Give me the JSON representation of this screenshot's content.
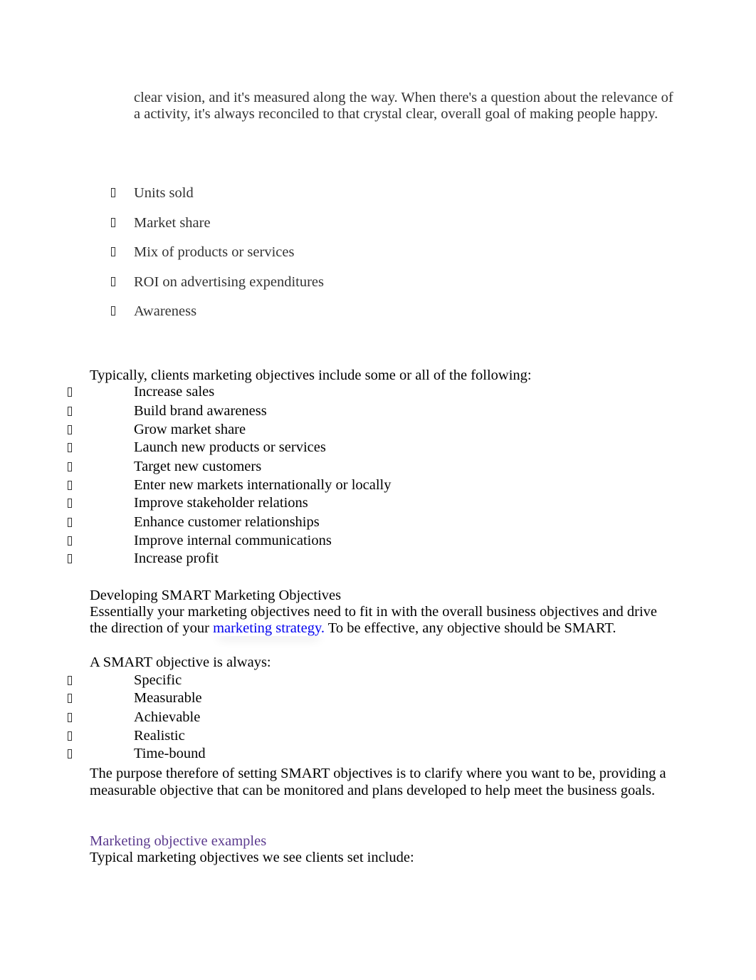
{
  "intro_paragraph": "clear vision, and it's measured along the way. When there's a question about the relevance of a activity, it's always reconciled to that crystal clear, overall goal of making people happy.",
  "metrics_list": [
    {
      "label": "Units sold",
      "bullet_icon": "missing-glyph-box"
    },
    {
      "label": "Market share",
      "bullet_icon": "missing-glyph-box"
    },
    {
      "label": "Mix of products or services",
      "bullet_icon": "missing-glyph-box"
    },
    {
      "label": "ROI on advertising expenditures",
      "bullet_icon": "missing-glyph-box"
    },
    {
      "label": "Awareness",
      "bullet_icon": "missing-glyph-box"
    }
  ],
  "objectives_section": {
    "intro": "Typically, clients marketing objectives include some or all of the following:",
    "items": [
      "Increase sales",
      "Build brand awareness",
      "Grow market share",
      "Launch new products or services",
      "Target new customers",
      "Enter new markets internationally or locally",
      "Improve stakeholder relations",
      "Enhance customer relationships",
      "Improve internal communications",
      "Increase profit"
    ]
  },
  "smart_section": {
    "heading": "Developing SMART Marketing Objectives",
    "body_before_link": "Essentially your marketing objectives need to fit in with the overall business objectives and drive the direction of your ",
    "link_text": "marketing strategy.",
    "body_after_link": " To be effective, any objective should be SMART.",
    "list_intro": "A SMART objective is always:",
    "items": [
      "Specific",
      "Measurable",
      "Achievable",
      "Realistic",
      "Time-bound"
    ],
    "purpose": "The purpose therefore of setting SMART objectives is to clarify where you want to be, providing a measurable objective that can be monitored and plans developed to help meet the business goals."
  },
  "examples_section": {
    "heading": "Marketing objective examples",
    "intro": "Typical marketing objectives we see clients set include:"
  },
  "colors": {
    "body_text": "#000000",
    "intro_text": "#333333",
    "link": "#0000ee",
    "section_heading": "#5b3a8e"
  }
}
